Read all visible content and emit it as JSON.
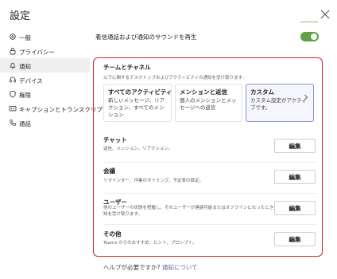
{
  "window": {
    "title": "設定"
  },
  "nav": {
    "items": [
      {
        "label": "一般",
        "icon": "gear-icon",
        "selected": false
      },
      {
        "label": "プライバシー",
        "icon": "lock-icon",
        "selected": false
      },
      {
        "label": "通知",
        "icon": "bell-icon",
        "selected": true
      },
      {
        "label": "デバイス",
        "icon": "headset-icon",
        "selected": false
      },
      {
        "label": "権限",
        "icon": "shield-icon",
        "selected": false
      },
      {
        "label": "キャプションとトランスクリプト",
        "icon": "caption-icon",
        "selected": false
      },
      {
        "label": "通話",
        "icon": "phone-icon",
        "selected": false
      }
    ]
  },
  "main": {
    "sound_label": "着信通話および通知のサウンドを再生",
    "sound_toggle_on": true,
    "section_title": "チームとチャネル",
    "section_desc": "以下に関するデスクトップおよびアクティビティの通知を受け取ります:",
    "cards": [
      {
        "title": "すべてのアクティビティ",
        "desc": "新しいメッセージ、リアクション、すべてのメンション",
        "selected": false
      },
      {
        "title": "メンションと返信",
        "desc": "個人のメンションとメッセージへの返信",
        "selected": false
      },
      {
        "title": "カスタム",
        "desc": "カスタム設定がアクティブです。",
        "selected": true
      }
    ],
    "rows": [
      {
        "title": "チャット",
        "desc": "返信、メンション、リアクション。",
        "button": "編集"
      },
      {
        "title": "会議",
        "desc": "リマインダー、作業のタイミング、予定表の設定。",
        "button": "編集"
      },
      {
        "title": "ユーザー",
        "desc": "他のユーザーの状態を把握し、そのユーザーが連絡可能またはオフラインになったときに通知を受け取ります。",
        "button": "編集"
      },
      {
        "title": "その他",
        "desc": "Teams からのおすすめ、ヒント、プロンプト。",
        "button": "編集"
      }
    ],
    "help_text": "ヘルプが必要ですか?",
    "help_link": "通知について"
  },
  "colors": {
    "accent": "#6264a7",
    "toggle_on": "#5da244",
    "highlight_border": "#e0232f"
  }
}
